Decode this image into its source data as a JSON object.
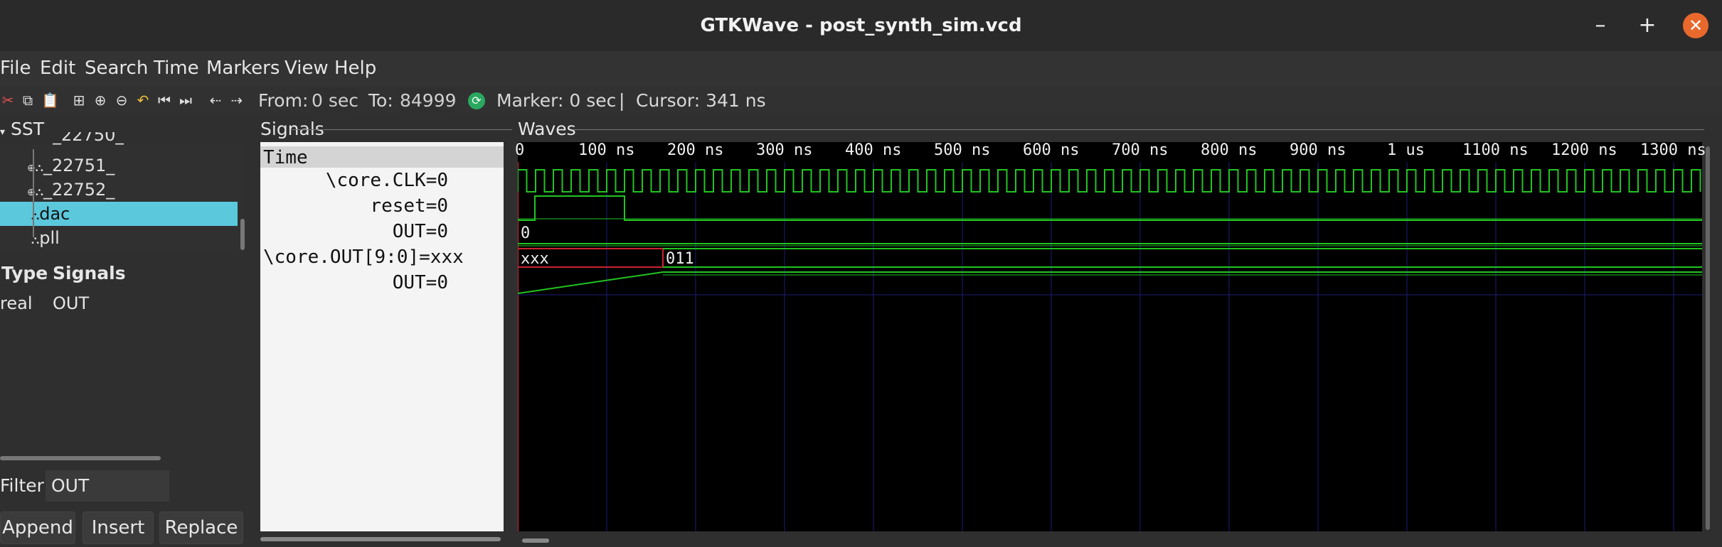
{
  "window": {
    "title": "GTKWave - post_synth_sim.vcd"
  },
  "menu": [
    "File",
    "Edit",
    "Search",
    "Time",
    "Markers",
    "View",
    "Help"
  ],
  "toolbar": {
    "from_label": "From:",
    "from_value": "0 sec",
    "to_label": "To:",
    "to_value": "84999",
    "marker": "Marker: 0 sec",
    "separator": "|",
    "cursor": "Cursor: 341 ns"
  },
  "sst": {
    "label": "SST",
    "items": [
      "_22751_",
      "_22752_",
      "dac",
      "pll"
    ],
    "partial_item": "_22750_",
    "selected": "dac"
  },
  "signal_table": {
    "col_type": "Type",
    "col_signals": "Signals",
    "rows": [
      {
        "type": "real",
        "name": "OUT"
      }
    ]
  },
  "filter": {
    "label": "Filter:",
    "value": "OUT"
  },
  "buttons": {
    "append": "Append",
    "insert": "Insert",
    "replace": "Replace"
  },
  "signals_header": "Signals",
  "signals": [
    "Time",
    "\\core.CLK=0",
    "reset=0",
    "OUT=0",
    "\\core.OUT[9:0]=xxx",
    "OUT=0"
  ],
  "waves": {
    "header": "Waves",
    "ruler": [
      "0",
      "100 ns",
      "200 ns",
      "300 ns",
      "400 ns",
      "500 ns",
      "600 ns",
      "700 ns",
      "800 ns",
      "900 ns",
      "1 us",
      "1100 ns",
      "1200 ns",
      "1300 ns"
    ],
    "out_value": "0",
    "bus_values": [
      "xxx",
      "011"
    ]
  },
  "colors": {
    "accent": "#e9692c",
    "selected": "#5bc8dc",
    "wave": "#22c422",
    "bus_x": "#cc2233",
    "grid": "#1c1c78"
  }
}
